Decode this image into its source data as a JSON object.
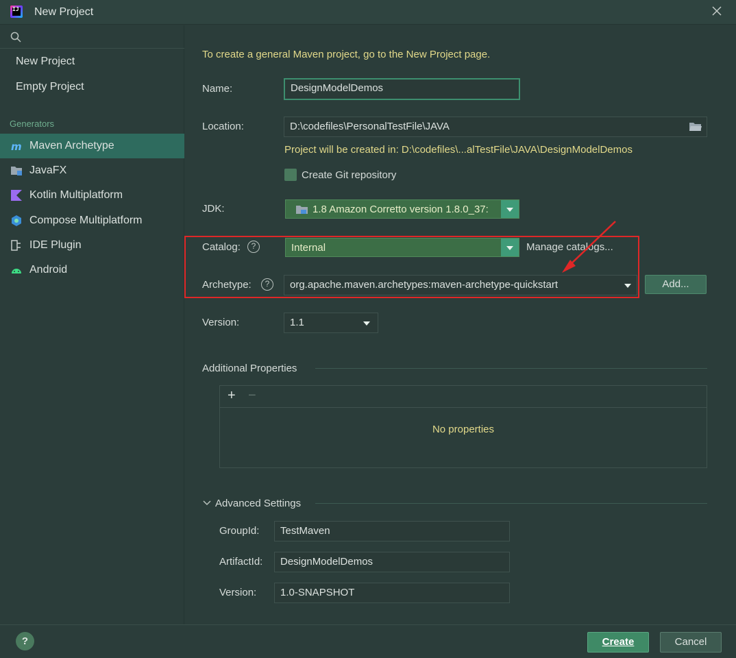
{
  "window": {
    "title": "New Project"
  },
  "sidebar": {
    "items": [
      {
        "label": "New Project"
      },
      {
        "label": "Empty Project"
      }
    ],
    "generators_label": "Generators",
    "generators": [
      {
        "label": "Maven Archetype",
        "icon": "maven-icon",
        "selected": true
      },
      {
        "label": "JavaFX",
        "icon": "javafx-icon"
      },
      {
        "label": "Kotlin Multiplatform",
        "icon": "kotlin-icon"
      },
      {
        "label": "Compose Multiplatform",
        "icon": "compose-icon"
      },
      {
        "label": "IDE Plugin",
        "icon": "plugin-icon"
      },
      {
        "label": "Android",
        "icon": "android-icon"
      }
    ]
  },
  "form": {
    "hint": "To create a general Maven project, go to the New Project page.",
    "name_label": "Name:",
    "name_value": "DesignModelDemos",
    "location_label": "Location:",
    "location_value": "D:\\codefiles\\PersonalTestFile\\JAVA",
    "location_info": "Project will be created in: D:\\codefiles\\...alTestFile\\JAVA\\DesignModelDemos",
    "git_label": "Create Git repository",
    "jdk_label": "JDK:",
    "jdk_value": "1.8 Amazon Corretto version 1.8.0_37:",
    "catalog_label": "Catalog:",
    "catalog_value": "Internal",
    "manage_catalogs": "Manage catalogs...",
    "archetype_label": "Archetype:",
    "archetype_value": "org.apache.maven.archetypes:maven-archetype-quickstart",
    "add_button": "Add...",
    "version_label": "Version:",
    "version_value": "1.1"
  },
  "additional": {
    "title": "Additional Properties",
    "add": "+",
    "remove": "−",
    "empty": "No properties"
  },
  "advanced": {
    "title": "Advanced Settings",
    "groupid_label": "GroupId:",
    "groupid_value": "TestMaven",
    "artifactid_label": "ArtifactId:",
    "artifactid_value": "DesignModelDemos",
    "version_label": "Version:",
    "version_value": "1.0-SNAPSHOT"
  },
  "footer": {
    "help": "?",
    "create": "Create",
    "cancel": "Cancel"
  },
  "colors": {
    "background": "#2b3d3a",
    "selected": "#2e6b5e",
    "accent": "#3f8a66",
    "hint_text": "#e2d98a",
    "annotation_red": "#e02727"
  }
}
